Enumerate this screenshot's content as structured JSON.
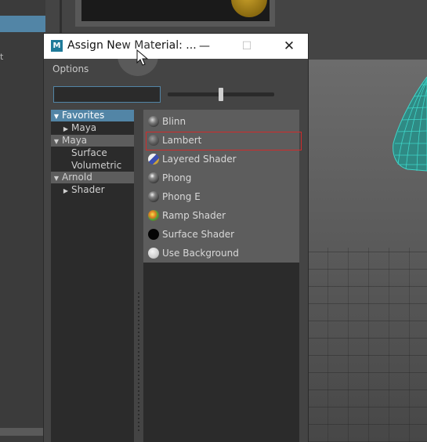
{
  "background": {
    "left_panel_letter": "t"
  },
  "dialog": {
    "title": "Assign New Material: ...",
    "minimize_glyph": "—",
    "maximize_glyph": "☐",
    "close_glyph": "✕",
    "options_label": "Options",
    "search_value": "",
    "slider_value_percent": 50
  },
  "tree": {
    "categories": [
      {
        "label": "Favorites",
        "expanded": true,
        "selected": true,
        "children": [
          {
            "label": "Maya",
            "expanded": false
          }
        ]
      },
      {
        "label": "Maya",
        "expanded": true,
        "selected": false,
        "children": [
          {
            "label": "Surface"
          },
          {
            "label": "Volumetric"
          }
        ]
      },
      {
        "label": "Arnold",
        "expanded": true,
        "selected": false,
        "children": [
          {
            "label": "Shader",
            "expanded": false
          }
        ]
      }
    ]
  },
  "materials": [
    {
      "label": "Blinn",
      "icon": "blinn-swatch-icon"
    },
    {
      "label": "Lambert",
      "icon": "lambert-swatch-icon",
      "highlighted": true
    },
    {
      "label": "Layered Shader",
      "icon": "layered-shader-swatch-icon"
    },
    {
      "label": "Phong",
      "icon": "phong-swatch-icon"
    },
    {
      "label": "Phong E",
      "icon": "phong-e-swatch-icon"
    },
    {
      "label": "Ramp Shader",
      "icon": "ramp-shader-swatch-icon"
    },
    {
      "label": "Surface Shader",
      "icon": "surface-shader-swatch-icon"
    },
    {
      "label": "Use Background",
      "icon": "use-background-swatch-icon"
    }
  ],
  "colors": {
    "selection": "#5285a6",
    "highlight_box": "#d12b2b",
    "mesh": "#3fd6c9"
  }
}
